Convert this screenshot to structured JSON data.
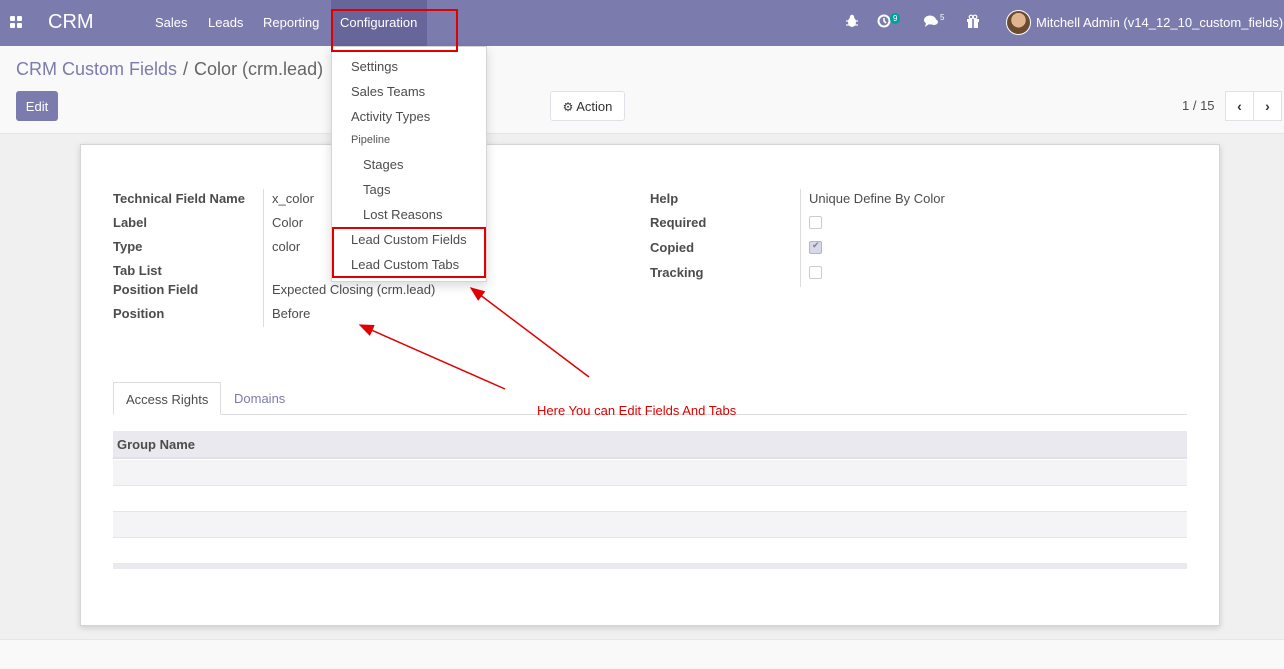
{
  "navbar": {
    "brand": "CRM",
    "menu": [
      "Sales",
      "Leads",
      "Reporting",
      "Configuration"
    ],
    "activity_count": "9",
    "message_count": "5",
    "user": "Mitchell Admin (v14_12_10_custom_fields)"
  },
  "breadcrumb": {
    "parent": "CRM Custom Fields",
    "separator": "/",
    "current": "Color (crm.lead)"
  },
  "buttons": {
    "edit": "Edit",
    "action": "Action"
  },
  "pager": {
    "value": "1 / 15"
  },
  "form": {
    "left": [
      {
        "label": "Technical Field Name",
        "value": "x_color"
      },
      {
        "label": "Label",
        "value": "Color"
      },
      {
        "label": "Type",
        "value": "color"
      },
      {
        "label": "Tab List",
        "value": ""
      },
      {
        "label": "Position Field",
        "value": "Expected Closing (crm.lead)"
      },
      {
        "label": "Position",
        "value": "Before"
      }
    ],
    "right": [
      {
        "label": "Help",
        "value": "Unique Define By Color"
      },
      {
        "label": "Required",
        "checked": false
      },
      {
        "label": "Copied",
        "checked": true
      },
      {
        "label": "Tracking",
        "checked": false
      }
    ]
  },
  "tabs": [
    "Access Rights",
    "Domains"
  ],
  "table": {
    "header": "Group Name"
  },
  "dropdown": {
    "items": [
      "Settings",
      "Sales Teams",
      "Activity Types"
    ],
    "section": "Pipeline",
    "sub_items": [
      "Stages",
      "Tags",
      "Lost Reasons"
    ],
    "custom_items": [
      "Lead Custom Fields",
      "Lead Custom Tabs"
    ]
  },
  "annotation": {
    "text": "Here You can Edit Fields And Tabs",
    "color": "#e00000"
  },
  "colors": {
    "primary": "#7c7bad",
    "primary_dark": "#67659a"
  }
}
